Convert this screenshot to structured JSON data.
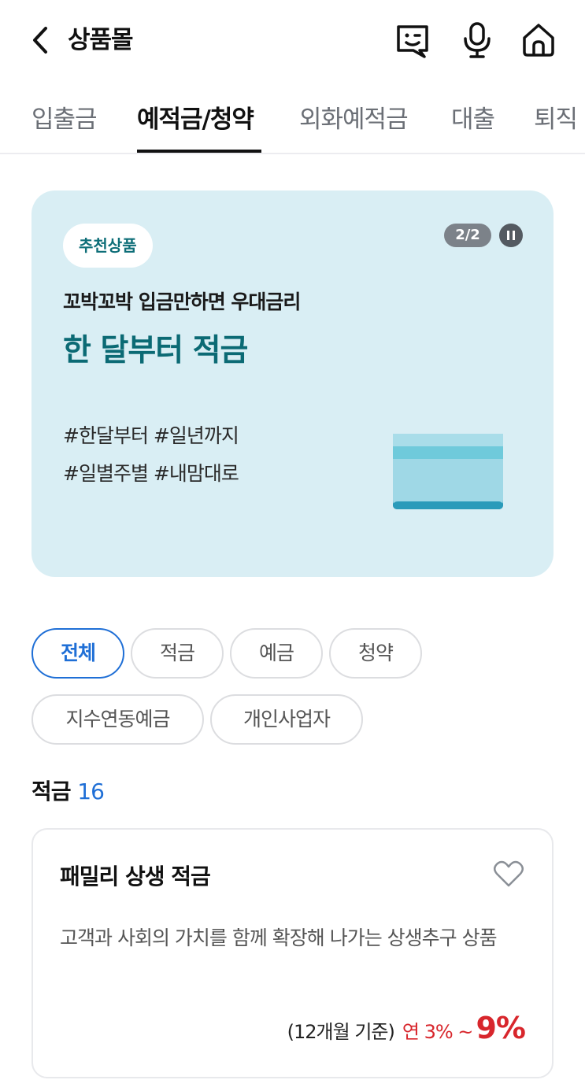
{
  "header": {
    "title": "상품몰",
    "icons": [
      "back-icon",
      "chatbot-icon",
      "microphone-icon",
      "home-icon"
    ]
  },
  "tabs": [
    {
      "label": "입출금",
      "active": false
    },
    {
      "label": "예적금/청약",
      "active": true
    },
    {
      "label": "외화예적금",
      "active": false
    },
    {
      "label": "대출",
      "active": false
    },
    {
      "label": "퇴직",
      "active": false
    }
  ],
  "banner": {
    "badge": "추천상품",
    "pager": "2/2",
    "subtitle": "꼬박꼬박 입금만하면 우대금리",
    "title": "한 달부터 적금",
    "tags_line1": "#한달부터 #일년까지",
    "tags_line2": "#일별주별 #내맘대로",
    "background": "#d9eef4",
    "title_color": "#0b6a74"
  },
  "filters": [
    {
      "label": "전체",
      "active": true
    },
    {
      "label": "적금",
      "active": false
    },
    {
      "label": "예금",
      "active": false
    },
    {
      "label": "청약",
      "active": false
    },
    {
      "label": "지수연동예금",
      "active": false
    },
    {
      "label": "개인사업자",
      "active": false
    }
  ],
  "section": {
    "title": "적금",
    "count": "16"
  },
  "product": {
    "name": "패밀리 상생 적금",
    "description": "고객과 사회의 가치를 함께 확장해 나가는 상생추구 상품",
    "basis": "(12개월 기준)",
    "rate_min": "연 3% ~",
    "rate_max": "9%",
    "favorite": false
  },
  "colors": {
    "accent": "#1f6fd6",
    "rate": "#d8262c"
  }
}
